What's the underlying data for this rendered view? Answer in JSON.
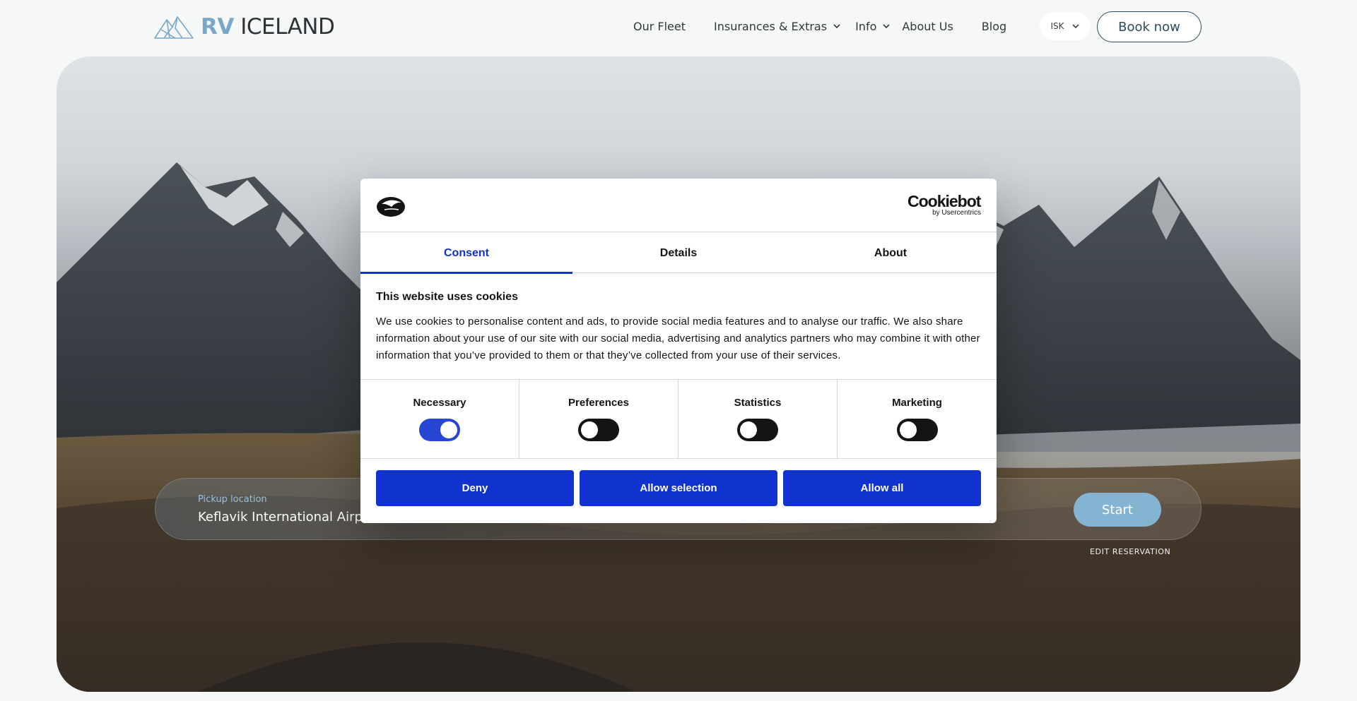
{
  "header": {
    "logo": {
      "rv": "RV",
      "iceland": "ICELAND"
    },
    "nav": [
      {
        "label": "Our Fleet"
      },
      {
        "label": "Insurances & Extras"
      },
      {
        "label": "Info"
      },
      {
        "label": "About Us"
      },
      {
        "label": "Blog"
      }
    ],
    "currency": "ISK",
    "book_label": "Book now"
  },
  "hero": {
    "headline": "",
    "search": {
      "pickup_label": "Pickup location",
      "pickup_value": "Keflavik International Airpo",
      "start_label": "Start"
    },
    "edit_reservation": "EDIT RESERVATION"
  },
  "cookie_dialog": {
    "brand_name": "Cookiebot",
    "brand_sub": "by Usercentrics",
    "tabs": [
      {
        "label": "Consent",
        "active": true
      },
      {
        "label": "Details",
        "active": false
      },
      {
        "label": "About",
        "active": false
      }
    ],
    "heading": "This website uses cookies",
    "text": "We use cookies to personalise content and ads, to provide social media features and to analyse our traffic. We also share information about your use of our site with our social media, advertising and analytics partners who may combine it with other information that you’ve provided to them or that they’ve collected from your use of their services.",
    "categories": [
      {
        "label": "Necessary",
        "on": true
      },
      {
        "label": "Preferences",
        "on": false
      },
      {
        "label": "Statistics",
        "on": false
      },
      {
        "label": "Marketing",
        "on": false
      }
    ],
    "buttons": {
      "deny": "Deny",
      "allow_selection": "Allow selection",
      "allow_all": "Allow all"
    },
    "accent_color": "#1032cf"
  }
}
